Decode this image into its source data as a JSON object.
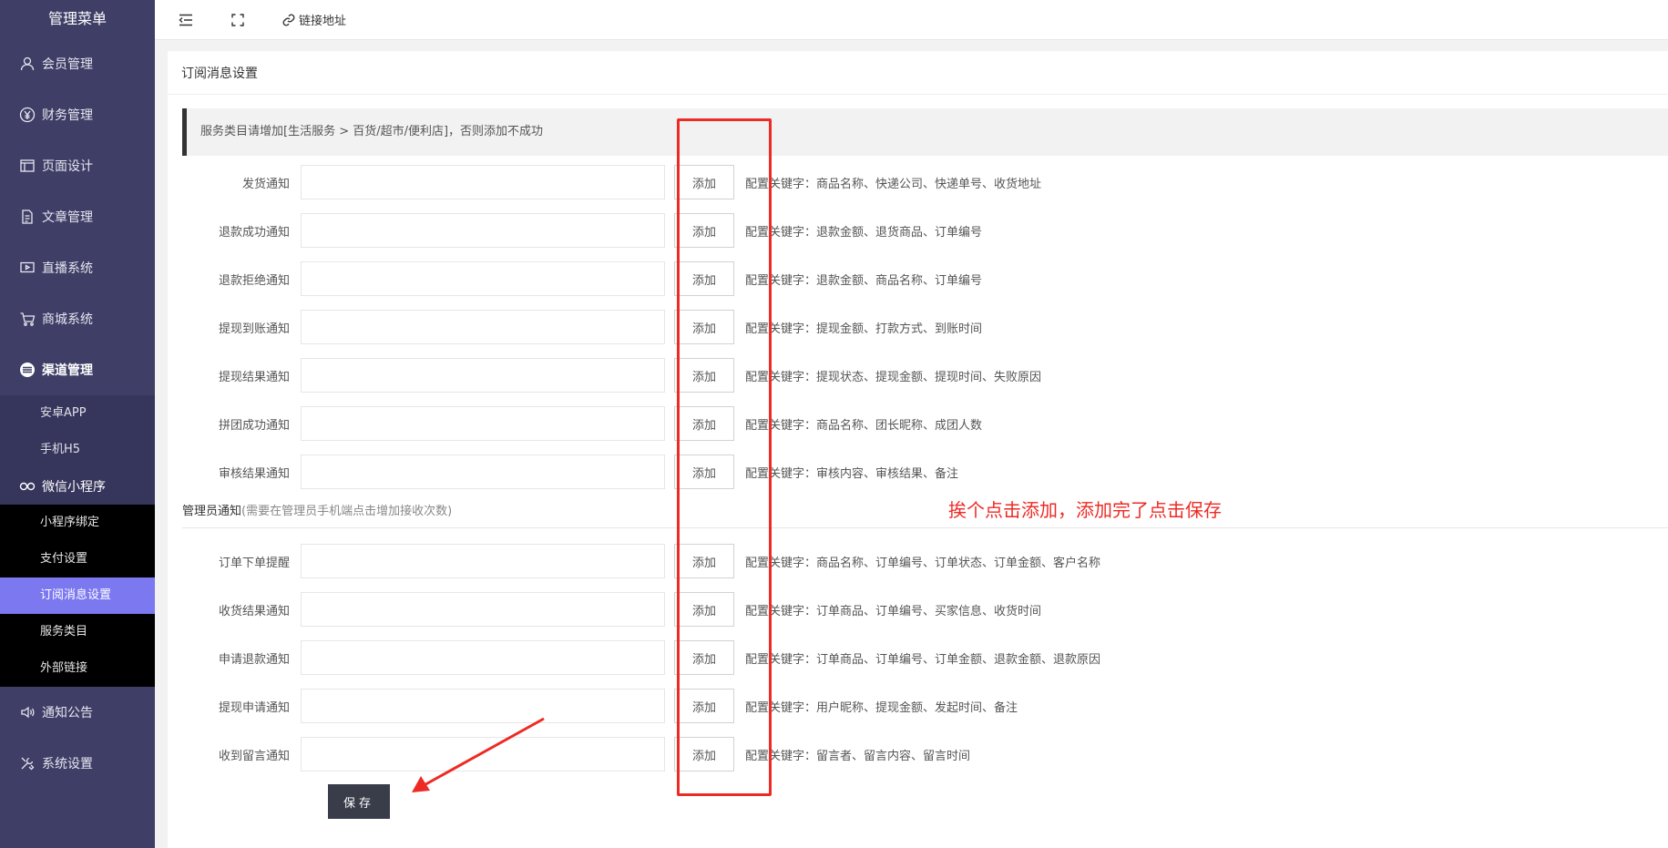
{
  "sidebar": {
    "brand": "管理菜单",
    "items": [
      {
        "label": "会员管理",
        "icon": "user-icon"
      },
      {
        "label": "财务管理",
        "icon": "yen-icon"
      },
      {
        "label": "页面设计",
        "icon": "layout-icon"
      },
      {
        "label": "文章管理",
        "icon": "document-icon"
      },
      {
        "label": "直播系统",
        "icon": "video-icon"
      },
      {
        "label": "商城系统",
        "icon": "cart-icon"
      },
      {
        "label": "渠道管理",
        "icon": "channel-icon"
      }
    ],
    "channel_sub": [
      "安卓APP",
      "手机H5"
    ],
    "wechat": {
      "label": "微信小程序",
      "icon": "wechat-icon",
      "items": [
        "小程序绑定",
        "支付设置",
        "订阅消息设置",
        "服务类目",
        "外部链接"
      ],
      "active": "订阅消息设置"
    },
    "bottom_items": [
      {
        "label": "通知公告",
        "icon": "speaker-icon"
      },
      {
        "label": "系统设置",
        "icon": "tools-icon"
      }
    ]
  },
  "topbar": {
    "link_label": "链接地址"
  },
  "card": {
    "title": "订阅消息设置",
    "notice": "服务类目请增加[生活服务 > 百货/超市/便利店]，否则添加不成功",
    "add_label": "添加",
    "user_rows": [
      {
        "label": "发货通知",
        "keywords": "配置关键字：商品名称、快递公司、快递单号、收货地址"
      },
      {
        "label": "退款成功通知",
        "keywords": "配置关键字：退款金额、退货商品、订单编号"
      },
      {
        "label": "退款拒绝通知",
        "keywords": "配置关键字：退款金额、商品名称、订单编号"
      },
      {
        "label": "提现到账通知",
        "keywords": "配置关键字：提现金额、打款方式、到账时间"
      },
      {
        "label": "提现结果通知",
        "keywords": "配置关键字：提现状态、提现金额、提现时间、失败原因"
      },
      {
        "label": "拼团成功通知",
        "keywords": "配置关键字：商品名称、团长昵称、成团人数"
      },
      {
        "label": "审核结果通知",
        "keywords": "配置关键字：审核内容、审核结果、备注"
      }
    ],
    "admin_title": "管理员通知",
    "admin_hint": "(需要在管理员手机端点击增加接收次数)",
    "admin_rows": [
      {
        "label": "订单下单提醒",
        "keywords": "配置关键字：商品名称、订单编号、订单状态、订单金额、客户名称"
      },
      {
        "label": "收货结果通知",
        "keywords": "配置关键字：订单商品、订单编号、买家信息、收货时间"
      },
      {
        "label": "申请退款通知",
        "keywords": "配置关键字：订单商品、订单编号、订单金额、退款金额、退款原因"
      },
      {
        "label": "提现申请通知",
        "keywords": "配置关键字：用户昵称、提现金额、发起时间、备注"
      },
      {
        "label": "收到留言通知",
        "keywords": "配置关键字：留言者、留言内容、留言时间"
      }
    ],
    "save_label": "保存"
  },
  "annotation": {
    "note": "挨个点击添加，添加完了点击保存",
    "color": "#ee2a24"
  }
}
